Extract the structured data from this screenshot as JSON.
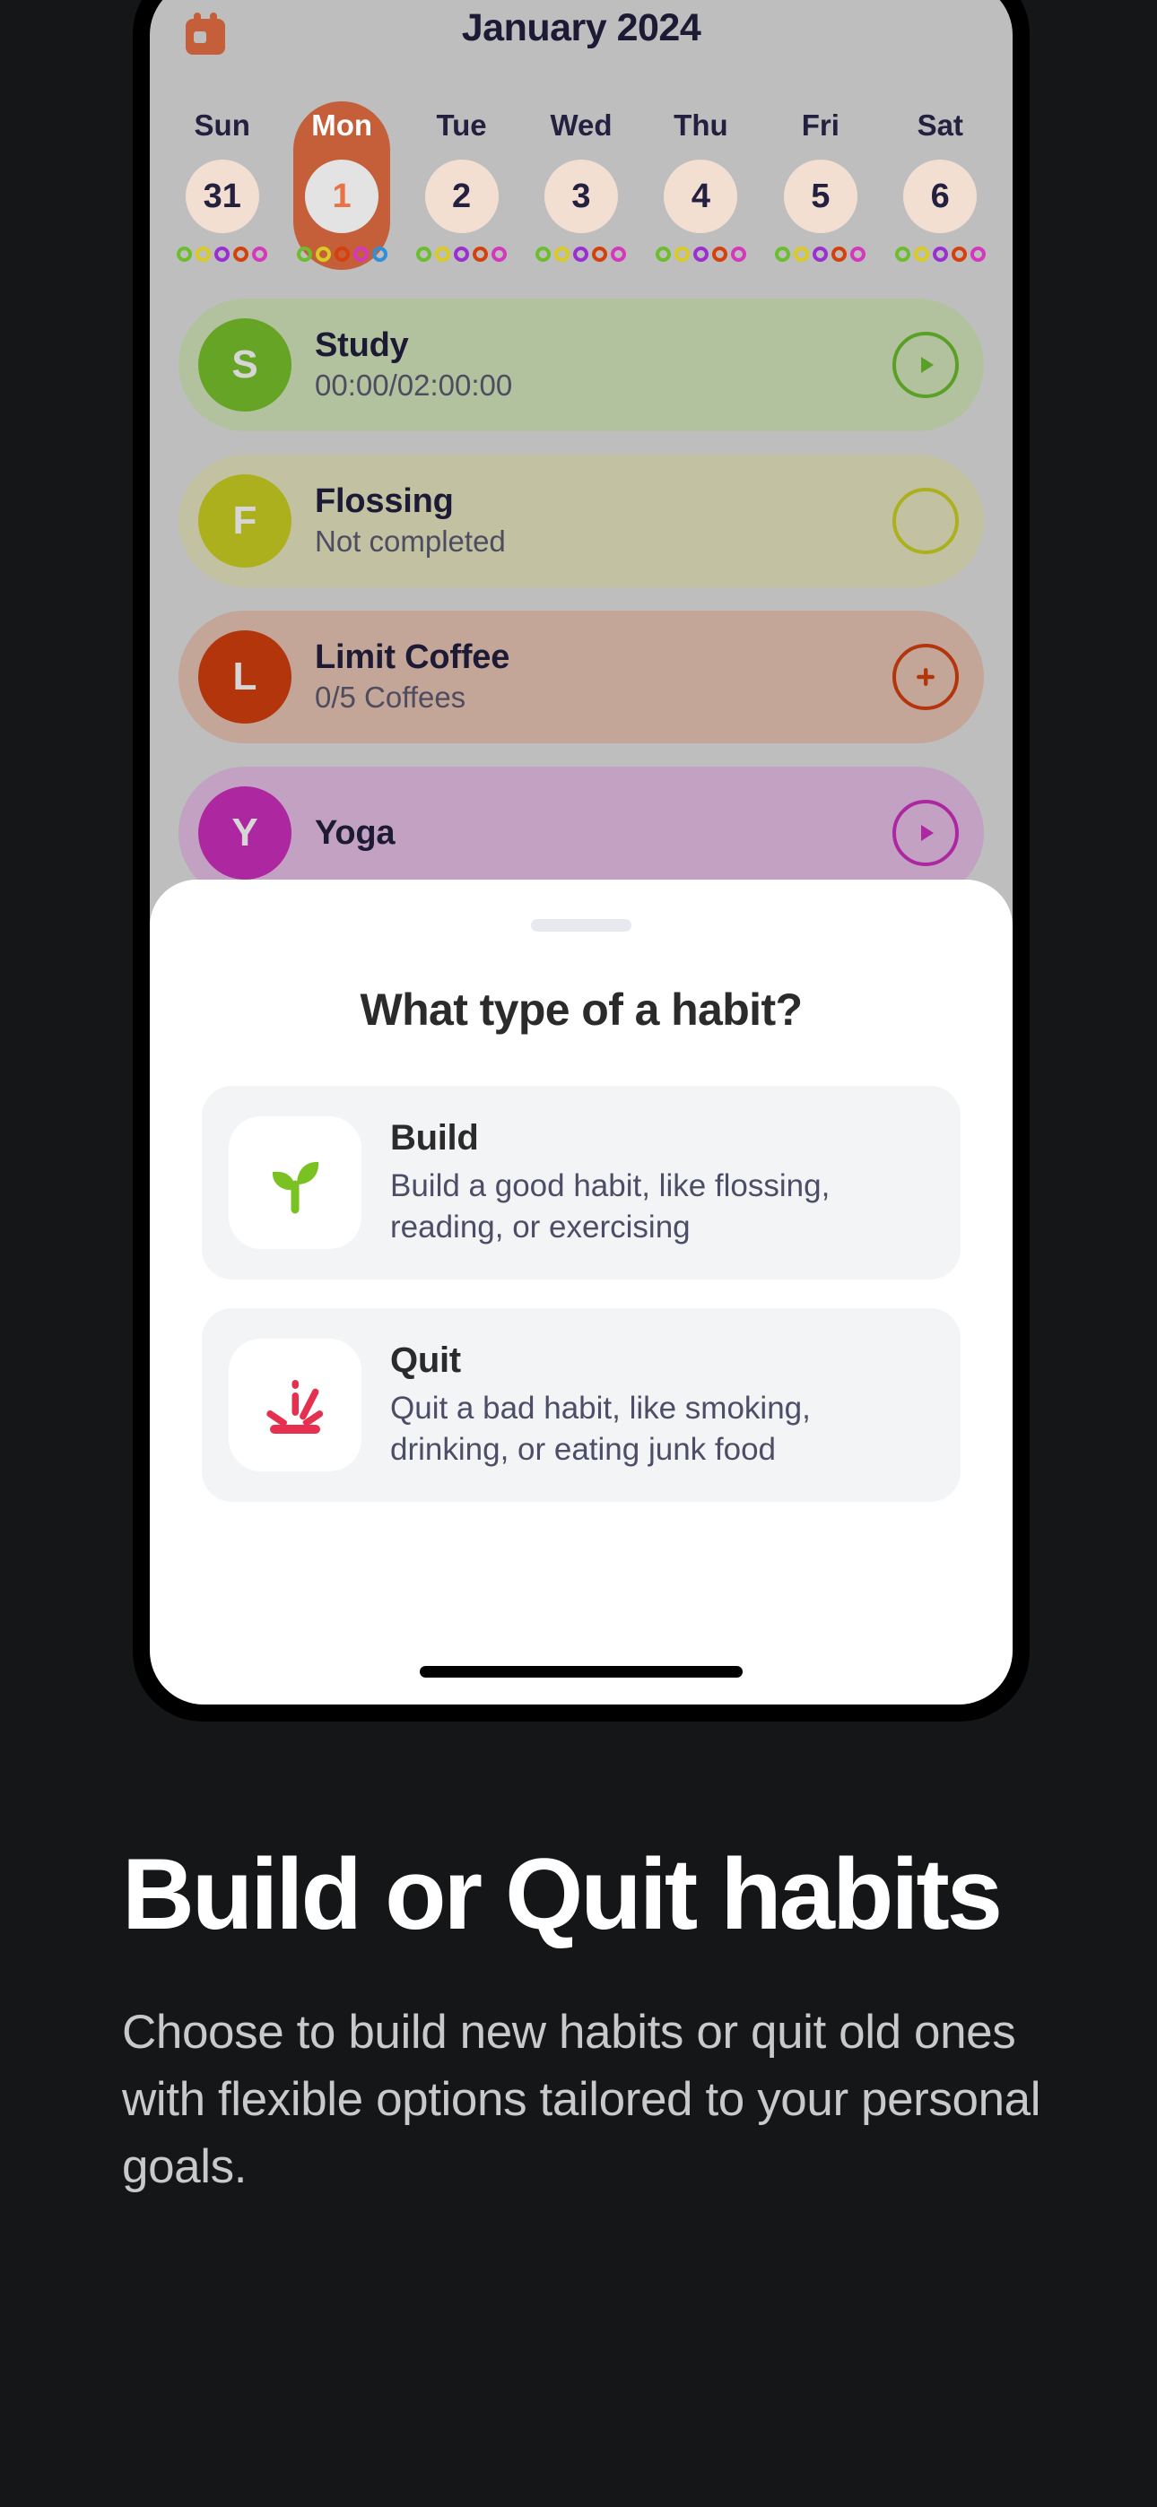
{
  "app": {
    "calendar_icon": "calendar-icon",
    "month_title": "January 2024",
    "week": [
      {
        "dow": "Sun",
        "day": "31",
        "selected": false,
        "dots": [
          "#6cbe2e",
          "#d8cc22",
          "#9b2fcf",
          "#d6400f",
          "#d338bd"
        ]
      },
      {
        "dow": "Mon",
        "day": "1",
        "selected": true,
        "dots": [
          "#6cbe2e",
          "#d8cc22",
          "#d6400f",
          "#d338bd",
          "#2e90d8"
        ]
      },
      {
        "dow": "Tue",
        "day": "2",
        "selected": false,
        "dots": [
          "#6cbe2e",
          "#d8cc22",
          "#9b2fcf",
          "#d6400f",
          "#d338bd"
        ]
      },
      {
        "dow": "Wed",
        "day": "3",
        "selected": false,
        "dots": [
          "#6cbe2e",
          "#d8cc22",
          "#9b2fcf",
          "#d6400f",
          "#d338bd"
        ]
      },
      {
        "dow": "Thu",
        "day": "4",
        "selected": false,
        "dots": [
          "#6cbe2e",
          "#d8cc22",
          "#9b2fcf",
          "#d6400f",
          "#d338bd"
        ]
      },
      {
        "dow": "Fri",
        "day": "5",
        "selected": false,
        "dots": [
          "#6cbe2e",
          "#d8cc22",
          "#9b2fcf",
          "#d6400f",
          "#d338bd"
        ]
      },
      {
        "dow": "Sat",
        "day": "6",
        "selected": false,
        "dots": [
          "#6cbe2e",
          "#d8cc22",
          "#9b2fcf",
          "#d6400f",
          "#d338bd"
        ]
      }
    ],
    "habits": [
      {
        "initial": "S",
        "name": "Study",
        "sub": "00:00/02:00:00",
        "avatar_color": "#7ac42e",
        "card_color": "#d6e7bd",
        "action": "play-icon",
        "action_color": "#6cbe2e"
      },
      {
        "initial": "F",
        "name": "Flossing",
        "sub": "Not completed",
        "avatar_color": "#ccd222",
        "card_color": "#e7e8c3",
        "action": "checkbox-empty-icon",
        "action_color": "#ccd222"
      },
      {
        "initial": "L",
        "name": "Limit Coffee",
        "sub": "0/5 Coffees",
        "avatar_color": "#d6400f",
        "card_color": "#e9c6b5",
        "action": "plus-icon",
        "action_color": "#d6400f"
      },
      {
        "initial": "Y",
        "name": "Yoga",
        "sub": "",
        "avatar_color": "#cf2fc0",
        "card_color": "#e8c0e7",
        "action": "play-icon",
        "action_color": "#cf2fc0"
      }
    ]
  },
  "sheet": {
    "grabber": "drag-handle",
    "title": "What type of a habit?",
    "options": [
      {
        "icon": "sprout-icon",
        "title": "Build",
        "desc": "Build a good habit, like flossing, reading, or exercising"
      },
      {
        "icon": "splat-icon",
        "title": "Quit",
        "desc": "Quit a bad habit, like smoking, drinking, or eating junk food"
      }
    ]
  },
  "marketing": {
    "headline": "Build or Quit habits",
    "subcopy": "Choose to build new habits or quit old ones with flexible options tailored to your personal goals."
  }
}
